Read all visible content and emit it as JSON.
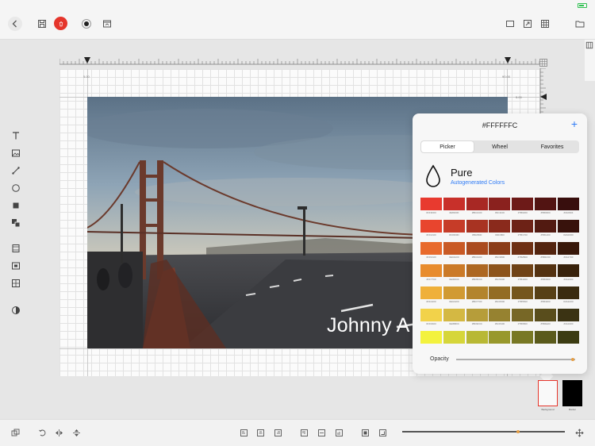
{
  "topbar": {
    "icons": [
      "back-icon",
      "save-icon",
      "delete-icon",
      "record-icon",
      "image-icon",
      "rectangle-icon",
      "resize-icon",
      "grid-icon",
      "folder-icon"
    ],
    "delete_color": "#e5352b"
  },
  "left_tools": [
    "text-icon",
    "image-icon",
    "line-icon",
    "circle-icon",
    "square-icon",
    "layer-icon",
    "film-icon",
    "frame-icon",
    "gallery-icon",
    "contrast-icon"
  ],
  "ruler": {
    "left_guide_label": "5.00",
    "right_guide_label": "90.00",
    "vertical_guide_label": "5.00"
  },
  "canvas": {
    "overlay_text": "Johnny A"
  },
  "color_picker": {
    "hex": "#FFFFFFC",
    "add_label": "+",
    "tabs": [
      {
        "label": "Picker",
        "active": true
      },
      {
        "label": "Wheel",
        "active": false
      },
      {
        "label": "Favorites",
        "active": false
      }
    ],
    "palette_title": "Pure",
    "palette_subtitle": "Autogenerated Colors",
    "opacity_label": "Opacity",
    "opacity_value": 0.98,
    "swatches": [
      [
        {
          "color": "#e83a2f",
          "label": "#FF3D00"
        },
        {
          "color": "#c8302a",
          "label": "#E83000"
        },
        {
          "color": "#a82824",
          "label": "#BD2100"
        },
        {
          "color": "#8a211e",
          "label": "#9C1100"
        },
        {
          "color": "#6d1a18",
          "label": "#7B0200"
        },
        {
          "color": "#521412",
          "label": "#5B0300"
        },
        {
          "color": "#380e0d",
          "label": "#3A0304"
        }
      ],
      [
        {
          "color": "#e8452e",
          "label": "#FF4A00"
        },
        {
          "color": "#c63c28",
          "label": "#D0390D"
        },
        {
          "color": "#a83322",
          "label": "#B02B00"
        },
        {
          "color": "#8a2a1c",
          "label": "#901800"
        },
        {
          "color": "#6d2216",
          "label": "#7B1700"
        },
        {
          "color": "#521a11",
          "label": "#5B1200"
        },
        {
          "color": "#38120c",
          "label": "#3A0D00"
        }
      ],
      [
        {
          "color": "#e86a2c",
          "label": "#FF6A00"
        },
        {
          "color": "#c95a25",
          "label": "#E04A00"
        },
        {
          "color": "#aa4b1f",
          "label": "#BD4400"
        },
        {
          "color": "#8b3d19",
          "label": "#9C3800"
        },
        {
          "color": "#6e3014",
          "label": "#7B2B00"
        },
        {
          "color": "#53240f",
          "label": "#5B1F00"
        },
        {
          "color": "#38180a",
          "label": "#3A1700"
        }
      ],
      [
        {
          "color": "#e88c2e",
          "label": "#FF7700"
        },
        {
          "color": "#cb7a28",
          "label": "#E06D00"
        },
        {
          "color": "#ad6722",
          "label": "#BD5F00"
        },
        {
          "color": "#8d541c",
          "label": "#9C5000"
        },
        {
          "color": "#704317",
          "label": "#7B4300"
        },
        {
          "color": "#543211",
          "label": "#5B3300"
        },
        {
          "color": "#38220b",
          "label": "#3A2400"
        }
      ],
      [
        {
          "color": "#efb03a",
          "label": "#FFA400"
        },
        {
          "color": "#d19a33",
          "label": "#E0A400"
        },
        {
          "color": "#b3842c",
          "label": "#BD7700"
        },
        {
          "color": "#936c24",
          "label": "#9C6600"
        },
        {
          "color": "#75561d",
          "label": "#7B5500"
        },
        {
          "color": "#574016",
          "label": "#5B4200"
        },
        {
          "color": "#3a2b0f",
          "label": "#3A2A00"
        }
      ],
      [
        {
          "color": "#f2d24a",
          "label": "#FFD400"
        },
        {
          "color": "#d4b843",
          "label": "#E0B800"
        },
        {
          "color": "#b69d3a",
          "label": "#BD9F00"
        },
        {
          "color": "#968230",
          "label": "#9C8400"
        },
        {
          "color": "#776726",
          "label": "#7B6800"
        },
        {
          "color": "#594d1c",
          "label": "#5B4E00"
        },
        {
          "color": "#3b3313",
          "label": "#3A3400"
        }
      ],
      [
        {
          "color": "#f3f23e",
          "label": ""
        },
        {
          "color": "#d6d63a",
          "label": ""
        },
        {
          "color": "#b8b834",
          "label": ""
        },
        {
          "color": "#98982c",
          "label": ""
        },
        {
          "color": "#787824",
          "label": ""
        },
        {
          "color": "#5a5a1b",
          "label": ""
        },
        {
          "color": "#3c3c12",
          "label": ""
        }
      ]
    ]
  },
  "color_targets": {
    "background": {
      "label": "Background",
      "color": "#f9f9f9",
      "selected_color": "#e5352b"
    },
    "border": {
      "label": "Border",
      "color": "#000000"
    }
  },
  "bottombar": {
    "zoom_value": 0.71,
    "accent": "#e59e45"
  }
}
